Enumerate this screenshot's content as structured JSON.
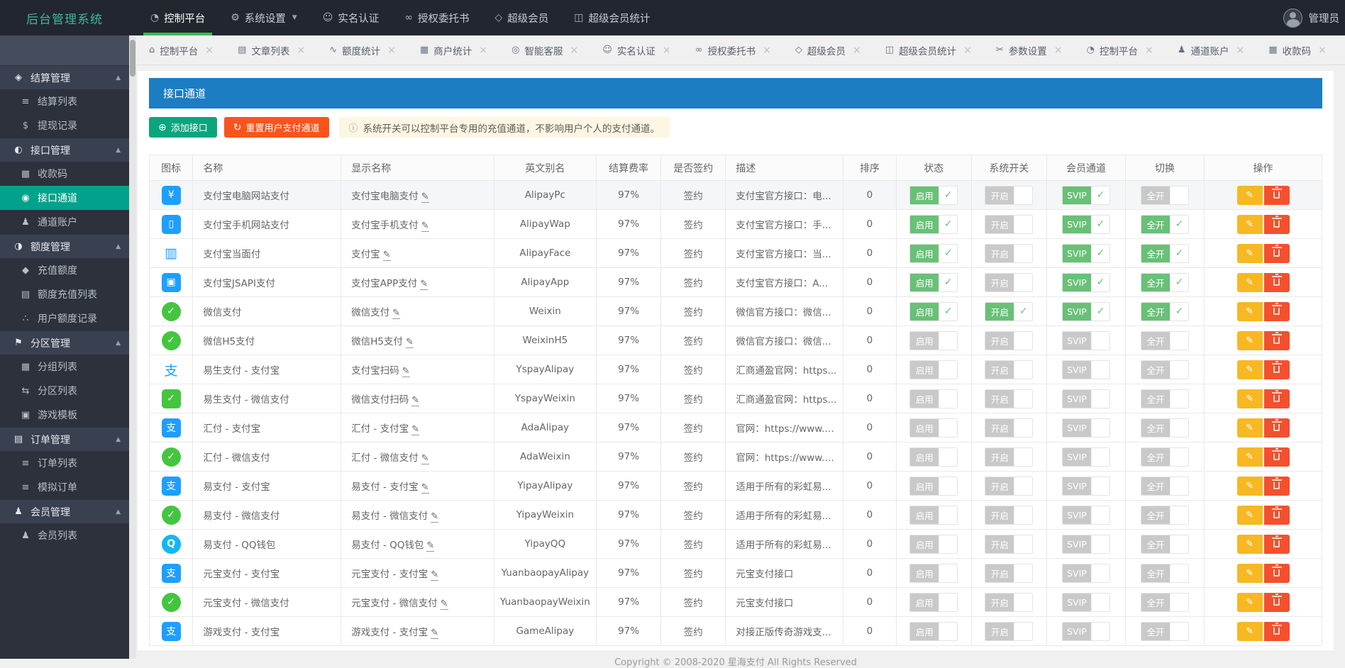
{
  "brand": {
    "title": "后台管理系统"
  },
  "topnav": {
    "items": [
      {
        "label": "控制平台",
        "icon": "dashboard-icon",
        "active": true
      },
      {
        "label": "系统设置",
        "icon": "gear-icon",
        "dropdown": true
      },
      {
        "label": "实名认证",
        "icon": "face-icon"
      },
      {
        "label": "授权委托书",
        "icon": "glasses-icon"
      },
      {
        "label": "超级会员",
        "icon": "diamond-icon"
      },
      {
        "label": "超级会员统计",
        "icon": "chart-icon"
      }
    ],
    "user": {
      "name": "管理员"
    }
  },
  "tabs": [
    {
      "label": "控制平台",
      "icon": "home-icon"
    },
    {
      "label": "文章列表",
      "icon": "doc-icon"
    },
    {
      "label": "额度统计",
      "icon": "pulse-icon"
    },
    {
      "label": "商户统计",
      "icon": "grid-icon"
    },
    {
      "label": "智能客服",
      "icon": "service-icon"
    },
    {
      "label": "实名认证",
      "icon": "face-icon"
    },
    {
      "label": "授权委托书",
      "icon": "glasses-icon"
    },
    {
      "label": "超级会员",
      "icon": "diamond-icon"
    },
    {
      "label": "超级会员统计",
      "icon": "chart-icon"
    },
    {
      "label": "参数设置",
      "icon": "scissors-icon"
    },
    {
      "label": "控制平台",
      "icon": "clock-icon"
    },
    {
      "label": "通道账户",
      "icon": "user-icon"
    },
    {
      "label": "收款码",
      "icon": "qr-icon"
    }
  ],
  "sidebar": {
    "entries": [
      {
        "type": "group",
        "label": "结算管理",
        "icon": "tag-icon"
      },
      {
        "type": "item",
        "label": "结算列表",
        "icon": "list-icon"
      },
      {
        "type": "item",
        "label": "提现记录",
        "icon": "money-icon"
      },
      {
        "type": "group",
        "label": "接口管理",
        "icon": "api-icon"
      },
      {
        "type": "item",
        "label": "收款码",
        "icon": "qr-icon"
      },
      {
        "type": "item",
        "label": "接口通道",
        "icon": "palette-icon",
        "active": true
      },
      {
        "type": "item",
        "label": "通道账户",
        "icon": "user-icon"
      },
      {
        "type": "group",
        "label": "额度管理",
        "icon": "quota-icon"
      },
      {
        "type": "item",
        "label": "充值额度",
        "icon": "gem-icon"
      },
      {
        "type": "item",
        "label": "额度充值列表",
        "icon": "file-icon"
      },
      {
        "type": "item",
        "label": "用户额度记录",
        "icon": "drops-icon"
      },
      {
        "type": "group",
        "label": "分区管理",
        "icon": "flag-icon"
      },
      {
        "type": "item",
        "label": "分组列表",
        "icon": "group-icon"
      },
      {
        "type": "item",
        "label": "分区列表",
        "icon": "partition-icon"
      },
      {
        "type": "item",
        "label": "游戏模板",
        "icon": "template-icon"
      },
      {
        "type": "group",
        "label": "订单管理",
        "icon": "order-icon"
      },
      {
        "type": "item",
        "label": "订单列表",
        "icon": "lines-icon"
      },
      {
        "type": "item",
        "label": "模拟订单",
        "icon": "lines-icon"
      },
      {
        "type": "group",
        "label": "会员管理",
        "icon": "users-icon"
      },
      {
        "type": "item",
        "label": "会员列表",
        "icon": "users-icon"
      }
    ]
  },
  "page": {
    "title": "接口通道"
  },
  "toolbar": {
    "add_label": "添加接口",
    "reset_label": "重置用户支付通道",
    "notice": "系统开关可以控制平台专用的充值通道，不影响用户个人的支付通道。"
  },
  "table": {
    "columns": [
      "图标",
      "名称",
      "显示名称",
      "英文别名",
      "结算费率",
      "是否签约",
      "描述",
      "排序",
      "状态",
      "系统开关",
      "会员通道",
      "切换",
      "操作"
    ],
    "switch_labels": {
      "status": "启用",
      "system": "开启",
      "svip": "SVIP",
      "toggle": "全开"
    },
    "rows": [
      {
        "icon": "alipay-pc",
        "name": "支付宝电脑网站支付",
        "display": "支付宝电脑支付",
        "alias": "AlipayPc",
        "rate": "97%",
        "signed": "签约",
        "desc": "支付宝官方接口：电...",
        "sort": "0",
        "status": true,
        "system": false,
        "svip": true,
        "toggle": false,
        "hover": true
      },
      {
        "icon": "alipay-phone",
        "name": "支付宝手机网站支付",
        "display": "支付宝手机支付",
        "alias": "AlipayWap",
        "rate": "97%",
        "signed": "签约",
        "desc": "支付宝官方接口：手...",
        "sort": "0",
        "status": true,
        "system": false,
        "svip": true,
        "toggle": true
      },
      {
        "icon": "alipay-face",
        "name": "支付宝当面付",
        "display": "支付宝",
        "alias": "AlipayFace",
        "rate": "97%",
        "signed": "签约",
        "desc": "支付宝官方接口：当...",
        "sort": "0",
        "status": true,
        "system": false,
        "svip": true,
        "toggle": true
      },
      {
        "icon": "alipay-app",
        "name": "支付宝JSAPI支付",
        "display": "支付宝APP支付",
        "alias": "AlipayApp",
        "rate": "97%",
        "signed": "签约",
        "desc": "支付宝官方接口：A...",
        "sort": "0",
        "status": true,
        "system": false,
        "svip": true,
        "toggle": true
      },
      {
        "icon": "wechat",
        "name": "微信支付",
        "display": "微信支付",
        "alias": "Weixin",
        "rate": "97%",
        "signed": "签约",
        "desc": "微信官方接口：微信...",
        "sort": "0",
        "status": true,
        "system": true,
        "svip": true,
        "toggle": true
      },
      {
        "icon": "wechat",
        "name": "微信H5支付",
        "display": "微信H5支付",
        "alias": "WeixinH5",
        "rate": "97%",
        "signed": "签约",
        "desc": "微信官方接口：微信...",
        "sort": "0",
        "status": false,
        "system": false,
        "svip": false,
        "toggle": false
      },
      {
        "icon": "alipay-scan",
        "name": "易生支付 - 支付宝",
        "display": "支付宝扫码",
        "alias": "YspayAlipay",
        "rate": "97%",
        "signed": "签约",
        "desc": "汇商通盈官网：https...",
        "sort": "0",
        "status": false,
        "system": false,
        "svip": false,
        "toggle": false
      },
      {
        "icon": "wechat-scan",
        "name": "易生支付 - 微信支付",
        "display": "微信支付扫码",
        "alias": "YspayWeixin",
        "rate": "97%",
        "signed": "签约",
        "desc": "汇商通盈官网：https...",
        "sort": "0",
        "status": false,
        "system": false,
        "svip": false,
        "toggle": false
      },
      {
        "icon": "alipay",
        "name": "汇付 - 支付宝",
        "display": "汇付 - 支付宝",
        "alias": "AdaAlipay",
        "rate": "97%",
        "signed": "签约",
        "desc": "官网：https://www.a...",
        "sort": "0",
        "status": false,
        "system": false,
        "svip": false,
        "toggle": false
      },
      {
        "icon": "wechat",
        "name": "汇付 - 微信支付",
        "display": "汇付 - 微信支付",
        "alias": "AdaWeixin",
        "rate": "97%",
        "signed": "签约",
        "desc": "官网：https://www.a...",
        "sort": "0",
        "status": false,
        "system": false,
        "svip": false,
        "toggle": false
      },
      {
        "icon": "alipay",
        "name": "易支付 - 支付宝",
        "display": "易支付 - 支付宝",
        "alias": "YipayAlipay",
        "rate": "97%",
        "signed": "签约",
        "desc": "适用于所有的彩虹易...",
        "sort": "0",
        "status": false,
        "system": false,
        "svip": false,
        "toggle": false
      },
      {
        "icon": "wechat",
        "name": "易支付 - 微信支付",
        "display": "易支付 - 微信支付",
        "alias": "YipayWeixin",
        "rate": "97%",
        "signed": "签约",
        "desc": "适用于所有的彩虹易...",
        "sort": "0",
        "status": false,
        "system": false,
        "svip": false,
        "toggle": false
      },
      {
        "icon": "qq",
        "name": "易支付 - QQ钱包",
        "display": "易支付 - QQ钱包",
        "alias": "YipayQQ",
        "rate": "97%",
        "signed": "签约",
        "desc": "适用于所有的彩虹易...",
        "sort": "0",
        "status": false,
        "system": false,
        "svip": false,
        "toggle": false
      },
      {
        "icon": "alipay",
        "name": "元宝支付 - 支付宝",
        "display": "元宝支付 - 支付宝",
        "alias": "YuanbaopayAlipay",
        "rate": "97%",
        "signed": "签约",
        "desc": "元宝支付接口",
        "sort": "0",
        "status": false,
        "system": false,
        "svip": false,
        "toggle": false
      },
      {
        "icon": "wechat",
        "name": "元宝支付 - 微信支付",
        "display": "元宝支付 - 微信支付",
        "alias": "YuanbaopayWeixin",
        "rate": "97%",
        "signed": "签约",
        "desc": "元宝支付接口",
        "sort": "0",
        "status": false,
        "system": false,
        "svip": false,
        "toggle": false
      },
      {
        "icon": "alipay",
        "name": "游戏支付 - 支付宝",
        "display": "游戏支付 - 支付宝",
        "alias": "GameAlipay",
        "rate": "97%",
        "signed": "签约",
        "desc": "对接正版传奇游戏支...",
        "sort": "0",
        "status": false,
        "system": false,
        "svip": false,
        "toggle": false
      }
    ]
  },
  "footer": {
    "copyright": "Copyright © 2008-2020 星海支付 All Rights Reserved"
  },
  "colors": {
    "accent_teal": "#00a28b",
    "brand": "#3eb79c",
    "header_blue": "#1c7dc2",
    "button_teal": "#0aa57d",
    "button_orange": "#fa541c",
    "switch_on": "#69c077",
    "edit_yellow": "#f7b822",
    "delete_red": "#f4502e",
    "signed_green": "#5fbf5f"
  }
}
